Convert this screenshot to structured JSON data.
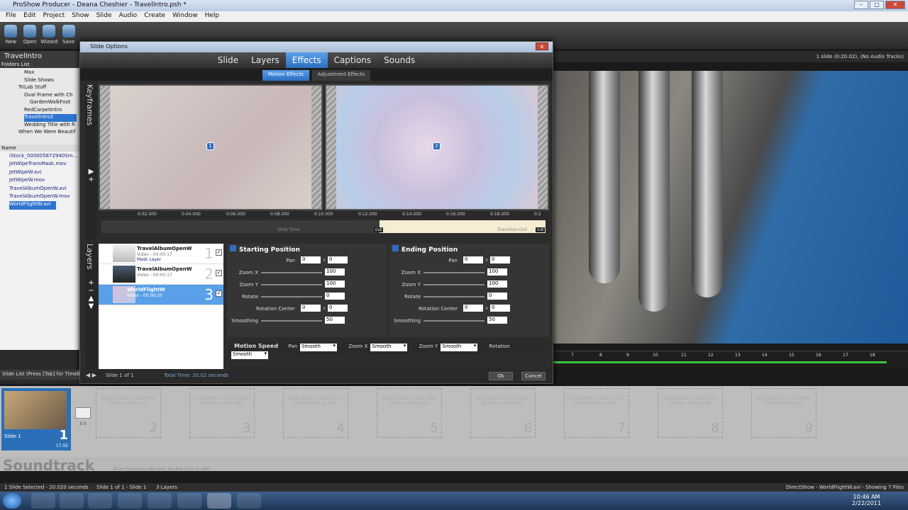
{
  "window": {
    "title": "ProShow Producer - Deana Cheshier - TravelIntro.psh *"
  },
  "menu": [
    "File",
    "Edit",
    "Project",
    "Show",
    "Slide",
    "Audio",
    "Create",
    "Window",
    "Help"
  ],
  "toolbar": [
    "New",
    "Open",
    "Wizard",
    "Save"
  ],
  "right_info": "1 slide (0:20.02), (No Audio Tracks)",
  "left": {
    "folders_header": "Folders List",
    "folders": [
      "Max",
      "Slide Shows",
      "TriLab Stuff",
      "Oval Frame with Ch",
      "GardenWalkFoot",
      "RedCarpetIntro",
      "TravelIntro2",
      "Wedding Title with R",
      "When We Were Beautif"
    ],
    "files_header": "Name",
    "files": [
      "iStock_000005872940Sm...",
      "JetWipeTransMask.mov",
      "JetWipeW.avi",
      "JetWipeW.mov",
      "TravelAlbumOpenW.avi",
      "TravelAlbumOpenW.mov",
      "WorldFlightW.avi"
    ]
  },
  "dialog": {
    "title": "Slide Options",
    "close": "x",
    "tabs": [
      "Slide",
      "Layers",
      "Effects",
      "Captions",
      "Sounds"
    ],
    "active_tab": "Effects",
    "subtabs": [
      "Motion Effects",
      "Adjustment Effects"
    ],
    "keyframes_label": "Keyframes",
    "layers_label": "Layers",
    "marker1": "1",
    "marker2": "2",
    "ruler": [
      "0:02.000",
      "0:04.000",
      "0:06.000",
      "0:08.000",
      "0:10.000",
      "0:12.000",
      "0:14.000",
      "0:16.000",
      "0:18.000",
      "0:2"
    ],
    "slide_time": "Slide Time",
    "transition_out": "Transition Out",
    "cut1": "cut",
    "cut2": "cut",
    "layers": [
      {
        "name": "TravelAlbumOpenW",
        "sub": "Video - 00:00:17",
        "extra": "Mask Layer",
        "num": "1"
      },
      {
        "name": "TravelAlbumOpenW",
        "sub": "Video - 00:00:17",
        "extra": "",
        "num": "2"
      },
      {
        "name": "WorldFlightW",
        "sub": "Video - 00:00:20",
        "extra": "",
        "num": "3"
      }
    ],
    "start": {
      "title": "Starting Position",
      "pan": [
        "0",
        "0"
      ],
      "zoomx": "100",
      "zoomy": "100",
      "rotate": "0",
      "rotation_center": [
        "0",
        "0"
      ],
      "smoothing": "50"
    },
    "end": {
      "title": "Ending Position",
      "pan": [
        "0",
        "0"
      ],
      "zoomx": "100",
      "zoomy": "100",
      "rotate": "0",
      "rotation_center": [
        "0",
        "0"
      ],
      "smoothing": "50"
    },
    "labels": {
      "pan": "Pan",
      "zoomx": "Zoom X",
      "zoomy": "Zoom Y",
      "rotate": "Rotate",
      "rotcenter": "Rotation Center",
      "smoothing": "Smoothing"
    },
    "motion_speed": {
      "label": "Motion Speed",
      "pan_label": "Pan",
      "pan": "Smooth",
      "zoomx_label": "Zoom X",
      "zoomx": "Smooth",
      "zoomy_label": "Zoom Y",
      "zoomy": "Smooth",
      "rotation_label": "Rotation",
      "rotation": "Smooth"
    },
    "footer": {
      "slide": "Slide 1 of 1",
      "total": "Total Time: 20.02 seconds",
      "ok": "Ok",
      "cancel": "Cancel"
    }
  },
  "slidelist": {
    "header": "Slide List (Press [Tab] for Timeline)",
    "slide1_label": "Slide 1",
    "slide1_num": "1",
    "slide1_time": "17.02",
    "transition": "3.0",
    "empty_text": "Drag photos / video here. Double click to edit.",
    "slot_nums": [
      "2",
      "3",
      "4",
      "5",
      "6",
      "7",
      "8",
      "9"
    ]
  },
  "soundtrack": {
    "label": "Soundtrack",
    "hint": "Drag music/sounds here. Double click to edit."
  },
  "timeline_ticks": [
    "7",
    "8",
    "9",
    "10",
    "11",
    "12",
    "13",
    "14",
    "15",
    "16",
    "17",
    "18"
  ],
  "status": {
    "left": "1 Slide Selected - 20.020 seconds",
    "mid": "Slide 1 of 1 - Slide 1",
    "layers": "3 Layers",
    "right": "DirectShow - WorldFlightW.avi - Showing 7 Files"
  },
  "clock": {
    "time": "10:46 AM",
    "date": "2/22/2011"
  }
}
